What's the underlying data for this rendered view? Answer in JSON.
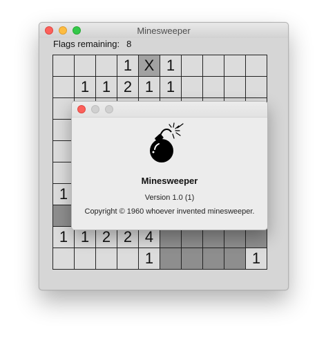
{
  "window": {
    "title": "Minesweeper"
  },
  "status": {
    "flags_label": "Flags remaining:",
    "flags_value": "8"
  },
  "board": {
    "rows": [
      [
        {
          "s": "h",
          "t": ""
        },
        {
          "s": "h",
          "t": ""
        },
        {
          "s": "h",
          "t": ""
        },
        {
          "s": "h",
          "t": "1"
        },
        {
          "s": "f",
          "t": "X"
        },
        {
          "s": "h",
          "t": "1"
        },
        {
          "s": "h",
          "t": ""
        },
        {
          "s": "h",
          "t": ""
        },
        {
          "s": "h",
          "t": ""
        },
        {
          "s": "h",
          "t": ""
        }
      ],
      [
        {
          "s": "h",
          "t": ""
        },
        {
          "s": "h",
          "t": "1"
        },
        {
          "s": "h",
          "t": "1"
        },
        {
          "s": "h",
          "t": "2"
        },
        {
          "s": "h",
          "t": "1"
        },
        {
          "s": "h",
          "t": "1"
        },
        {
          "s": "h",
          "t": ""
        },
        {
          "s": "h",
          "t": ""
        },
        {
          "s": "h",
          "t": ""
        },
        {
          "s": "h",
          "t": ""
        }
      ],
      [
        {
          "s": "h",
          "t": ""
        },
        {
          "s": "h",
          "t": ""
        },
        {
          "s": "h",
          "t": ""
        },
        {
          "s": "h",
          "t": ""
        },
        {
          "s": "h",
          "t": ""
        },
        {
          "s": "h",
          "t": ""
        },
        {
          "s": "h",
          "t": ""
        },
        {
          "s": "h",
          "t": ""
        },
        {
          "s": "h",
          "t": ""
        },
        {
          "s": "h",
          "t": ""
        }
      ],
      [
        {
          "s": "h",
          "t": ""
        },
        {
          "s": "h",
          "t": ""
        },
        {
          "s": "h",
          "t": ""
        },
        {
          "s": "h",
          "t": ""
        },
        {
          "s": "h",
          "t": ""
        },
        {
          "s": "h",
          "t": ""
        },
        {
          "s": "h",
          "t": ""
        },
        {
          "s": "h",
          "t": ""
        },
        {
          "s": "h",
          "t": ""
        },
        {
          "s": "h",
          "t": ""
        }
      ],
      [
        {
          "s": "h",
          "t": ""
        },
        {
          "s": "h",
          "t": ""
        },
        {
          "s": "h",
          "t": ""
        },
        {
          "s": "h",
          "t": ""
        },
        {
          "s": "h",
          "t": ""
        },
        {
          "s": "h",
          "t": ""
        },
        {
          "s": "h",
          "t": ""
        },
        {
          "s": "h",
          "t": ""
        },
        {
          "s": "h",
          "t": ""
        },
        {
          "s": "h",
          "t": ""
        }
      ],
      [
        {
          "s": "h",
          "t": ""
        },
        {
          "s": "h",
          "t": ""
        },
        {
          "s": "h",
          "t": ""
        },
        {
          "s": "h",
          "t": ""
        },
        {
          "s": "h",
          "t": ""
        },
        {
          "s": "h",
          "t": ""
        },
        {
          "s": "h",
          "t": ""
        },
        {
          "s": "h",
          "t": ""
        },
        {
          "s": "h",
          "t": ""
        },
        {
          "s": "h",
          "t": ""
        }
      ],
      [
        {
          "s": "h",
          "t": "1"
        },
        {
          "s": "h",
          "t": ""
        },
        {
          "s": "h",
          "t": ""
        },
        {
          "s": "h",
          "t": ""
        },
        {
          "s": "h",
          "t": ""
        },
        {
          "s": "h",
          "t": ""
        },
        {
          "s": "h",
          "t": ""
        },
        {
          "s": "h",
          "t": ""
        },
        {
          "s": "h",
          "t": ""
        },
        {
          "s": "h",
          "t": ""
        }
      ],
      [
        {
          "s": "r",
          "t": ""
        },
        {
          "s": "r",
          "t": ""
        },
        {
          "s": "r",
          "t": ""
        },
        {
          "s": "r",
          "t": ""
        },
        {
          "s": "r",
          "t": ""
        },
        {
          "s": "r",
          "t": ""
        },
        {
          "s": "r",
          "t": ""
        },
        {
          "s": "r",
          "t": ""
        },
        {
          "s": "r",
          "t": ""
        },
        {
          "s": "r",
          "t": ""
        }
      ],
      [
        {
          "s": "h",
          "t": "1"
        },
        {
          "s": "h",
          "t": "1"
        },
        {
          "s": "h",
          "t": "2"
        },
        {
          "s": "h",
          "t": "2"
        },
        {
          "s": "h",
          "t": "4"
        },
        {
          "s": "r",
          "t": ""
        },
        {
          "s": "r",
          "t": ""
        },
        {
          "s": "r",
          "t": ""
        },
        {
          "s": "r",
          "t": ""
        },
        {
          "s": "r",
          "t": ""
        }
      ],
      [
        {
          "s": "h",
          "t": ""
        },
        {
          "s": "h",
          "t": ""
        },
        {
          "s": "h",
          "t": ""
        },
        {
          "s": "h",
          "t": ""
        },
        {
          "s": "h",
          "t": "1"
        },
        {
          "s": "r",
          "t": ""
        },
        {
          "s": "r",
          "t": ""
        },
        {
          "s": "r",
          "t": ""
        },
        {
          "s": "r",
          "t": ""
        },
        {
          "s": "h",
          "t": "1"
        }
      ]
    ]
  },
  "about": {
    "app_name": "Minesweeper",
    "version": "Version 1.0 (1)",
    "copyright": "Copyright © 1960 whoever invented minesweeper.",
    "icon": "bomb-icon"
  }
}
